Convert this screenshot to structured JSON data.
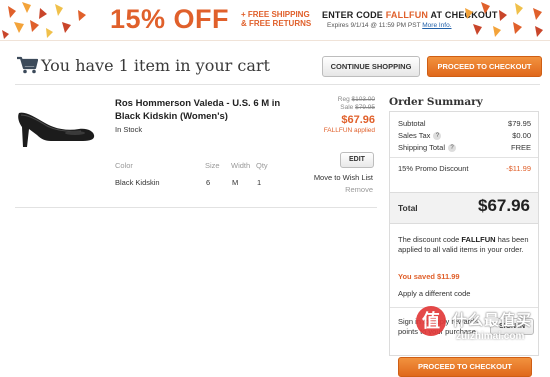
{
  "banner": {
    "offer": "15% OFF",
    "free_shipping": "+ FREE SHIPPING",
    "free_returns": "& FREE RETURNS",
    "enter_code_prefix": "ENTER CODE ",
    "code": "FALLFUN",
    "enter_code_suffix": " AT CHECKOUT",
    "expires": "Expires 9/1/14 @ 11:59 PM PST",
    "more_info": "More Info."
  },
  "header": {
    "cart_title": "You have 1 item in your cart",
    "continue_label": "CONTINUE SHOPPING",
    "checkout_label": "PROCEED TO CHECKOUT"
  },
  "item": {
    "name": "Ros Hommerson Valeda - U.S. 6 M in Black Kidskin (Women's)",
    "stock": "In Stock",
    "reg_label": "Reg ",
    "reg_price": "$103.00",
    "sale_label": "Sale ",
    "sale_price": "$79.95",
    "now_price": "$67.96",
    "applied": "FALLFUN applied",
    "headers": {
      "color": "Color",
      "size": "Size",
      "width": "Width",
      "qty": "Qty"
    },
    "values": {
      "color": "Black Kidskin",
      "size": "6",
      "width": "M",
      "qty": "1"
    },
    "edit_label": "EDIT",
    "wishlist_label": "Move to Wish List",
    "remove_label": "Remove"
  },
  "summary": {
    "title": "Order Summary",
    "subtotal_label": "Subtotal",
    "subtotal_value": "$79.95",
    "tax_label": "Sales Tax",
    "tax_value": "$0.00",
    "shipping_label": "Shipping Total",
    "shipping_value": "FREE",
    "discount_label": "15% Promo Discount",
    "discount_value": "-$11.99",
    "total_label": "Total",
    "total_value": "$67.96",
    "msg_prefix": "The discount code ",
    "msg_code": "FALLFUN",
    "msg_suffix": " has been applied to all valid items in your order.",
    "saved": "You saved $11.99",
    "different_code": "Apply a different code",
    "signin_text": "Sign in to apply rewards points to your purchase",
    "signin_label": "SIGN IN",
    "checkout_label": "PROCEED TO CHECKOUT"
  },
  "watermark": {
    "glyph": "值",
    "title": "什么最值买",
    "sub": "zuizhimai.com"
  },
  "colors": {
    "accent": "#e0602b",
    "checkout": "#e97a2c"
  },
  "icons": [
    "cart-icon",
    "question-icon",
    "leaves-decoration"
  ]
}
